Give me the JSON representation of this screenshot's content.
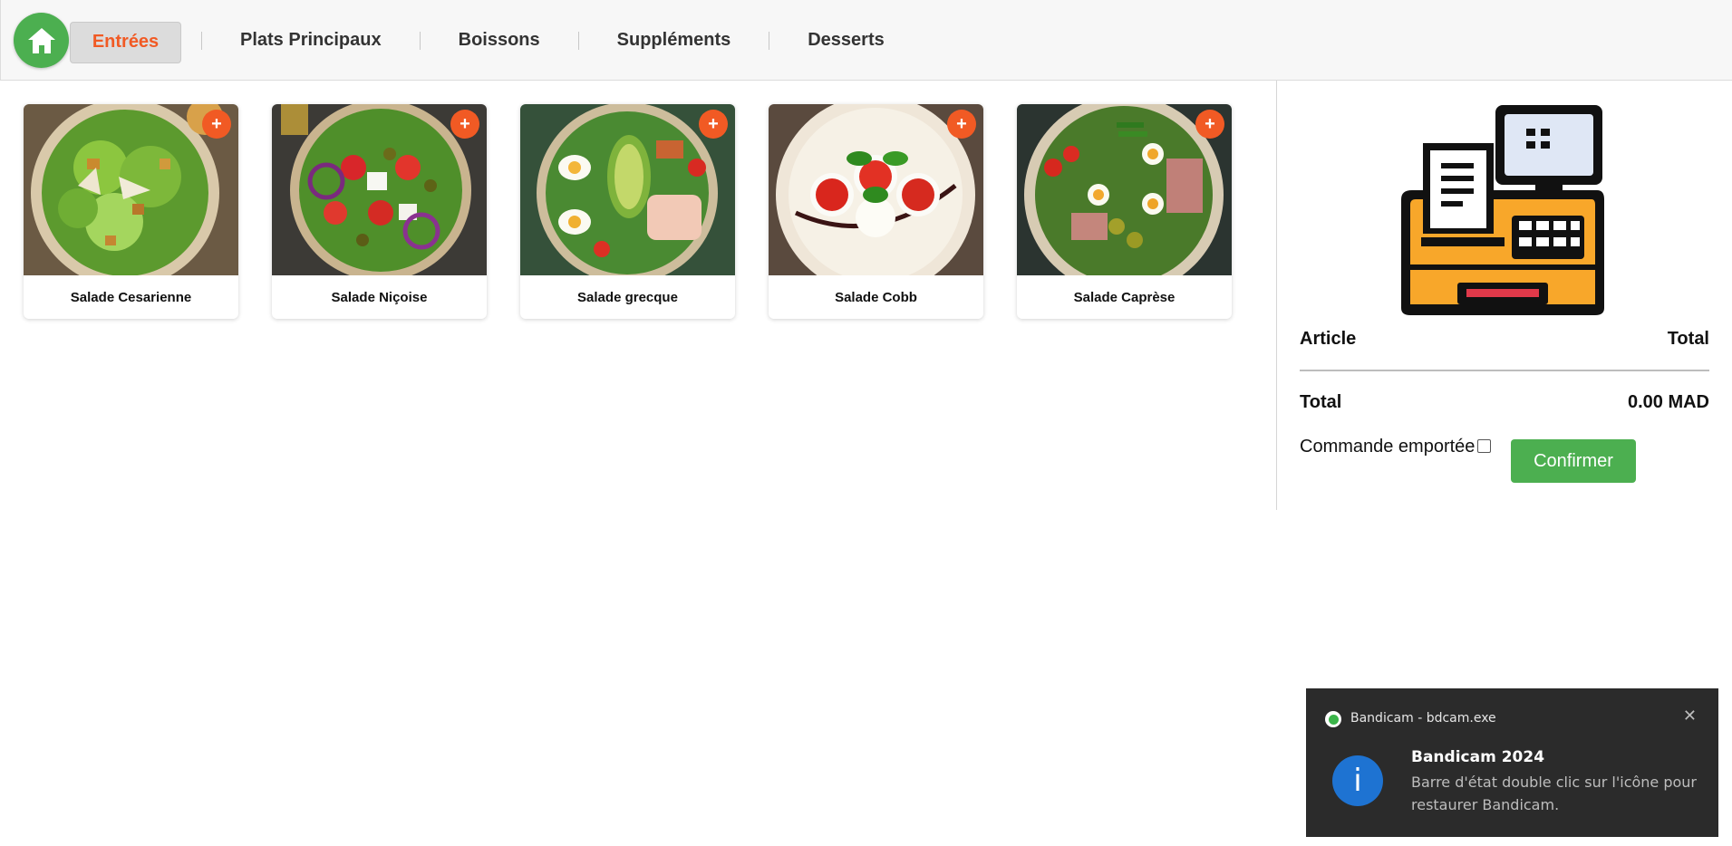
{
  "nav": {
    "home_icon": "home-icon",
    "tabs": [
      {
        "label": "Entrées",
        "active": true
      },
      {
        "label": "Plats Principaux",
        "active": false
      },
      {
        "label": "Boissons",
        "active": false
      },
      {
        "label": "Suppléments",
        "active": false
      },
      {
        "label": "Desserts",
        "active": false
      }
    ]
  },
  "products": [
    {
      "name": "Salade Cesarienne",
      "add_label": "+"
    },
    {
      "name": "Salade Niçoise",
      "add_label": "+"
    },
    {
      "name": "Salade grecque",
      "add_label": "+"
    },
    {
      "name": "Salade Cobb",
      "add_label": "+"
    },
    {
      "name": "Salade Caprèse",
      "add_label": "+"
    }
  ],
  "order": {
    "header_article": "Article",
    "header_total": "Total",
    "total_label": "Total",
    "total_value": "0.00 MAD",
    "takeaway_label": "Commande emportée",
    "takeaway_checked": false,
    "confirm_label": "Confirmer"
  },
  "toast": {
    "app_name": "Bandicam - bdcam.exe",
    "title": "Bandicam 2024",
    "message": "Barre d'état double clic sur l'icône pour restaurer Bandicam."
  },
  "colors": {
    "accent_orange": "#f15a24",
    "accent_green": "#4caf50",
    "nav_bg": "#f7f7f7",
    "toast_bg": "#2b2b2b"
  }
}
